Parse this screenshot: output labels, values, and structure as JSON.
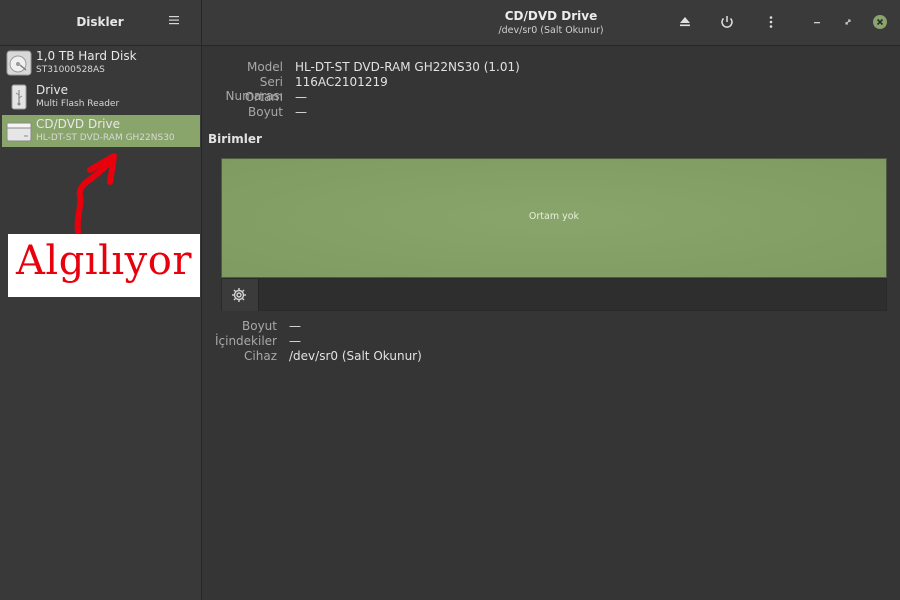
{
  "sidebar": {
    "title": "Diskler",
    "menu_icon": "hamburger-icon",
    "disks": [
      {
        "name": "1,0 TB Hard Disk",
        "sub": "ST31000528AS",
        "icon": "hard-disk-icon",
        "selected": false
      },
      {
        "name": "Drive",
        "sub": "Multi Flash Reader",
        "icon": "usb-icon",
        "selected": false
      },
      {
        "name": "CD/DVD Drive",
        "sub": "HL-DT-ST DVD-RAM GH22NS30",
        "icon": "optical-drive-icon",
        "selected": true
      }
    ]
  },
  "annotation": {
    "text": "Algılıyor",
    "color": "#e8000d"
  },
  "header": {
    "title": "CD/DVD Drive",
    "subtitle": "/dev/sr0 (Salt Okunur)",
    "buttons": [
      "eject-icon",
      "power-icon",
      "more-vertical-icon",
      "minimize-icon",
      "maximize-icon",
      "close-icon"
    ]
  },
  "drive_info": {
    "model_label": "Model",
    "model_value": "HL-DT-ST DVD-RAM GH22NS30 (1.01)",
    "serial_label": "Seri Numarası",
    "serial_value": "116AC2101219",
    "media_label": "Ortam",
    "media_value": "—",
    "size_label": "Boyut",
    "size_value": "—"
  },
  "volumes": {
    "title": "Birimler",
    "empty_text": "Ortam yok",
    "accent": "#8aa56b"
  },
  "volume_info": {
    "size_label": "Boyut",
    "size_value": "—",
    "contents_label": "İçindekiler",
    "contents_value": "—",
    "device_label": "Cihaz",
    "device_value": "/dev/sr0 (Salt Okunur)"
  }
}
